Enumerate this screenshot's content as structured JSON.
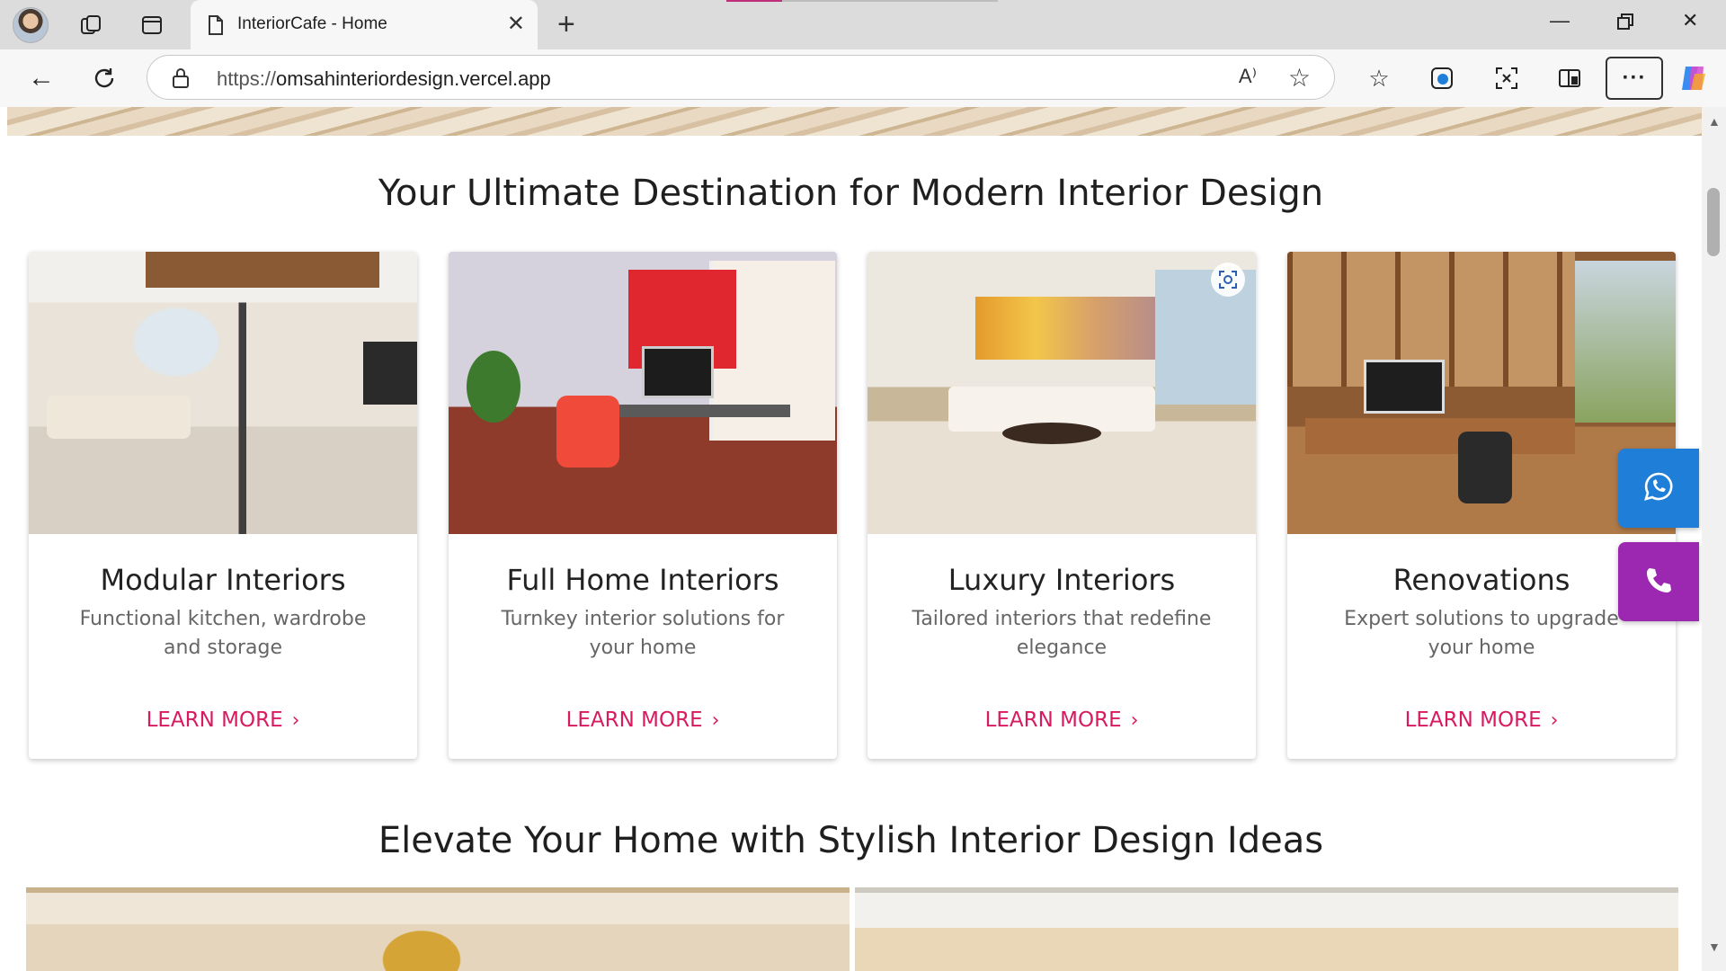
{
  "browser": {
    "tab_title": "InteriorCafe - Home",
    "url_protocol": "https://",
    "url_host": "omsahinteriordesign.vercel.app",
    "read_aloud_label": "A⁾"
  },
  "sections": {
    "services_heading": "Your Ultimate Destination for Modern Interior Design",
    "ideas_heading": "Elevate Your Home with Stylish Interior Design Ideas"
  },
  "cards": [
    {
      "title": "Modular Interiors",
      "description": "Functional kitchen, wardrobe and storage",
      "cta": "LEARN MORE"
    },
    {
      "title": "Full Home Interiors",
      "description": "Turnkey interior solutions for your home",
      "cta": "LEARN MORE"
    },
    {
      "title": "Luxury Interiors",
      "description": "Tailored interiors that redefine elegance",
      "cta": "LEARN MORE"
    },
    {
      "title": "Renovations",
      "description": "Expert solutions to upgrade your home",
      "cta": "LEARN MORE"
    }
  ],
  "floating_buttons": [
    {
      "icon": "whatsapp-icon",
      "color": "#1f7ed8"
    },
    {
      "icon": "phone-icon",
      "color": "#9c27b0"
    }
  ],
  "colors": {
    "accent": "#d81b60",
    "heading": "#1f1f1f",
    "body_text": "#666666"
  }
}
